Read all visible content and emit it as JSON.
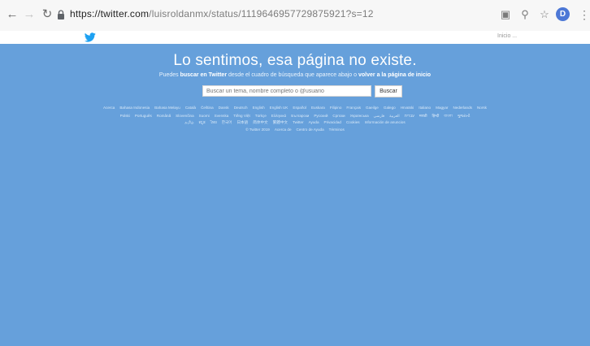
{
  "browser": {
    "url_host": "https://twitter.com",
    "url_path": "/luisroldanmx/status/1119646957729875921?s=12",
    "avatar_letter": "D",
    "icons": {
      "back": "arrow-left-icon",
      "forward": "arrow-right-icon",
      "reload": "reload-icon",
      "lock": "lock-icon",
      "translate": "translate-icon",
      "zoom": "magnifier-icon",
      "star": "star-icon",
      "menu": "kebab-menu-icon"
    }
  },
  "twitter_header": {
    "logo_icon": "twitter-bird-icon",
    "language_label": "Inicio ..."
  },
  "page": {
    "title": "Lo sentimos, esa página no existe.",
    "subtitle_prefix": "Puedes",
    "subtitle_link1": "buscar en Twitter",
    "subtitle_middle": "desde el cuadro de búsqueda que aparece abajo o",
    "subtitle_link2": "volver a la página de inicio",
    "search_placeholder": "Buscar un tema, nombre completo o @usuario",
    "search_button": "Buscar",
    "footer_rows": [
      [
        "Acerca",
        "Bahasa Indonesia",
        "Bahasa Melayu",
        "Català",
        "Čeština",
        "Dansk",
        "Deutsch",
        "English",
        "English UK",
        "Español",
        "Euskara",
        "Filipino",
        "Français",
        "Gaeilge",
        "Galego",
        "Hrvatski",
        "Italiano",
        "Magyar",
        "Nederlands",
        "Norsk"
      ],
      [
        "Polski",
        "Português",
        "Română",
        "Slovenčina",
        "Suomi",
        "Svenska",
        "Tiếng Việt",
        "Türkçe",
        "Ελληνικά",
        "Български",
        "Русский",
        "Српски",
        "Українська",
        "עברית",
        "العربية",
        "فارسی",
        "मराठी",
        "हिन्दी",
        "বাংলা",
        "ગુજરાતી"
      ],
      [
        "தமிழ்",
        "ಕನ್ನಡ",
        "ไทย",
        "한국어",
        "日本語",
        "简体中文",
        "繁體中文",
        "Twitter",
        "Ayuda",
        "Privacidad",
        "Cookies",
        "Información de anuncios"
      ],
      [
        "© Twitter 2019",
        "Acerca de",
        "Centro de Ayuda",
        "Términos"
      ]
    ]
  }
}
